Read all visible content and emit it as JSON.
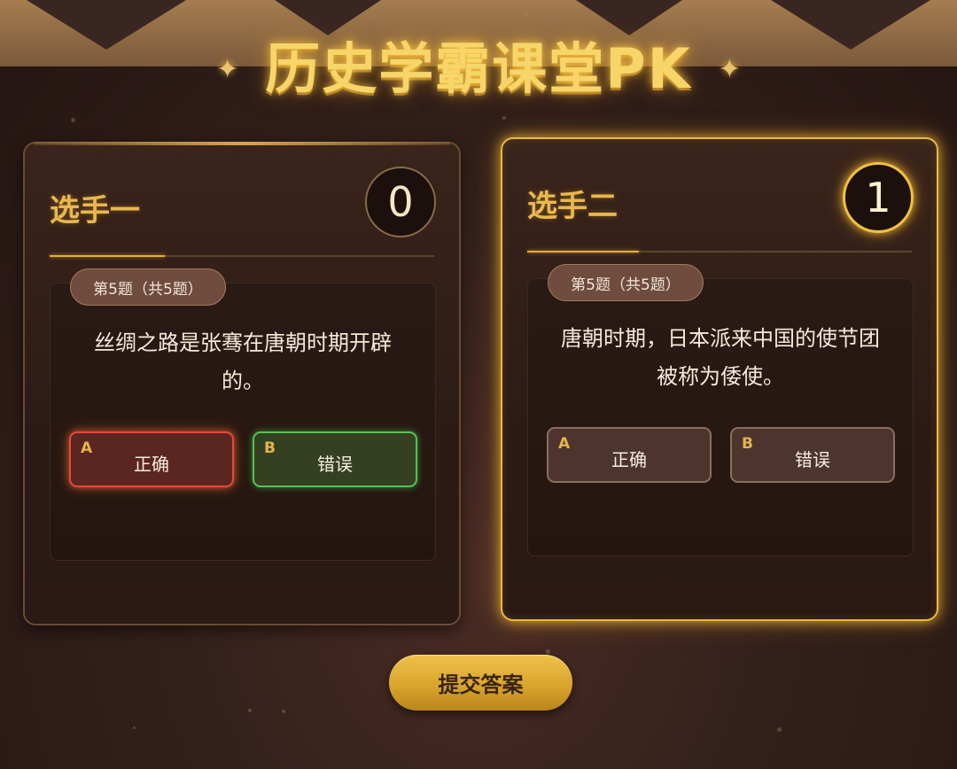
{
  "title": "历史学霸课堂PK",
  "players": [
    {
      "name": "选手一",
      "score": "0",
      "progress_fraction": 0.3,
      "question_counter": "第5题（共5题）",
      "question": "丝绸之路是张骞在唐朝时期开辟的。",
      "options": [
        {
          "letter": "A",
          "label": "正确",
          "state": "selected-wrong"
        },
        {
          "letter": "B",
          "label": "错误",
          "state": "correct"
        }
      ]
    },
    {
      "name": "选手二",
      "score": "1",
      "progress_fraction": 0.29,
      "question_counter": "第5题（共5题）",
      "question": "唐朝时期，日本派来中国的使节团被称为倭使。",
      "options": [
        {
          "letter": "A",
          "label": "正确",
          "state": "normal"
        },
        {
          "letter": "B",
          "label": "错误",
          "state": "normal"
        }
      ]
    }
  ],
  "submit_label": "提交答案",
  "colors": {
    "gold": "#e9b84e",
    "title_glow": "#f7d568",
    "wrong": "#e3493a",
    "correct": "#54c451",
    "active_border": "#e7bb40"
  }
}
